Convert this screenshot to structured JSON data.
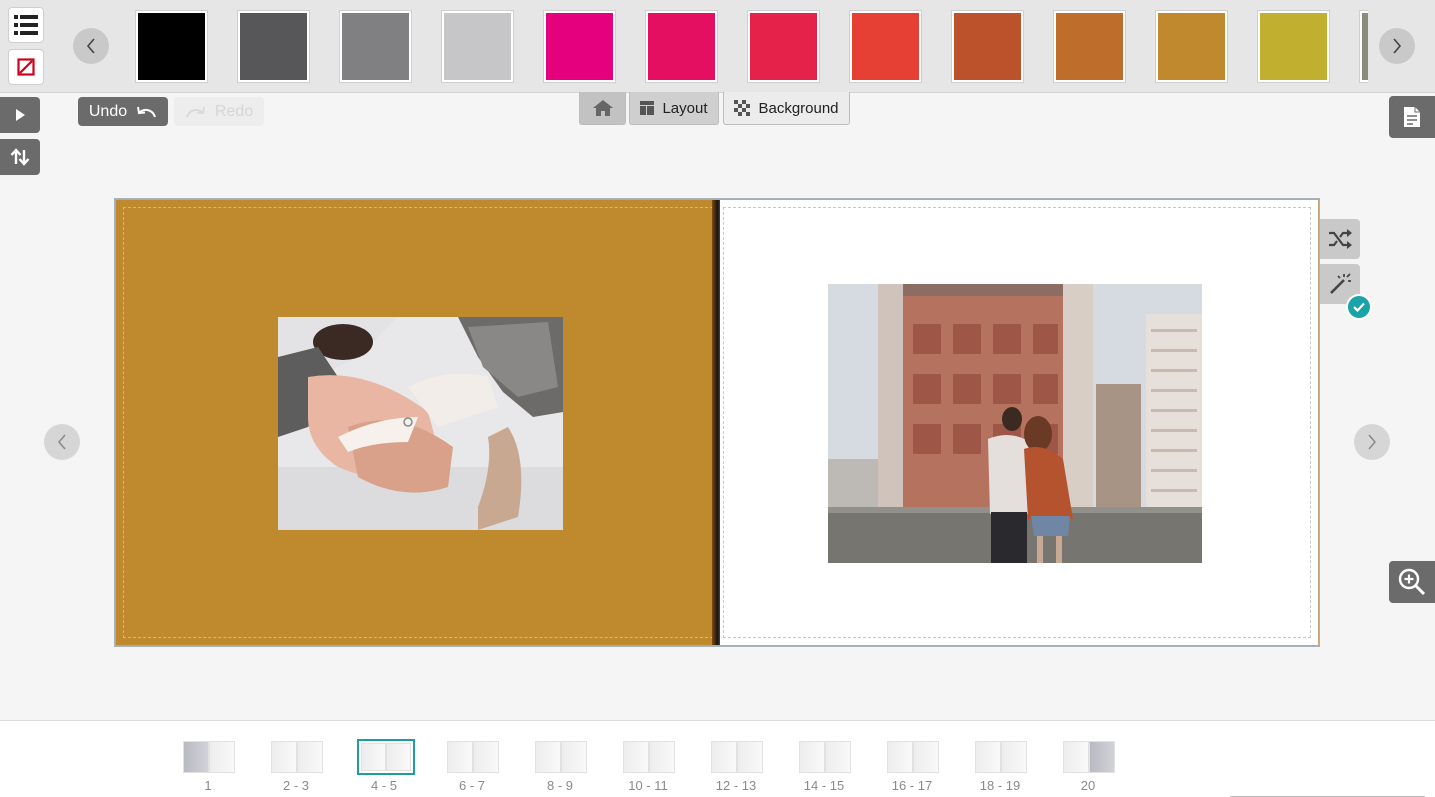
{
  "toolbar": {
    "undo_label": "Undo",
    "redo_label": "Redo"
  },
  "swatches": [
    "#000000",
    "#575759",
    "#808082",
    "#c6c6c8",
    "#e5017d",
    "#e40f60",
    "#e4224a",
    "#e63f33",
    "#bc522c",
    "#be6d2b",
    "#c0892d",
    "#c1b030",
    "#8a8c7d"
  ],
  "tabs": {
    "layout_label": "Layout",
    "background_label": "Background"
  },
  "spread": {
    "left_page_color": "#bf8a2e",
    "right_page_color": "#ffffff"
  },
  "thumbnails": [
    {
      "label": "1",
      "left_cover": true,
      "right_cover": false,
      "active": false
    },
    {
      "label": "2 - 3",
      "left_cover": false,
      "right_cover": false,
      "active": false
    },
    {
      "label": "4 - 5",
      "left_cover": false,
      "right_cover": false,
      "active": true
    },
    {
      "label": "6 - 7",
      "left_cover": false,
      "right_cover": false,
      "active": false
    },
    {
      "label": "8 - 9",
      "left_cover": false,
      "right_cover": false,
      "active": false
    },
    {
      "label": "10 - 11",
      "left_cover": false,
      "right_cover": false,
      "active": false
    },
    {
      "label": "12 - 13",
      "left_cover": false,
      "right_cover": false,
      "active": false
    },
    {
      "label": "14 - 15",
      "left_cover": false,
      "right_cover": false,
      "active": false
    },
    {
      "label": "16 - 17",
      "left_cover": false,
      "right_cover": false,
      "active": false
    },
    {
      "label": "18 - 19",
      "left_cover": false,
      "right_cover": false,
      "active": false
    },
    {
      "label": "20",
      "left_cover": false,
      "right_cover": true,
      "active": false
    }
  ],
  "accent_color": "#1e9ea3"
}
